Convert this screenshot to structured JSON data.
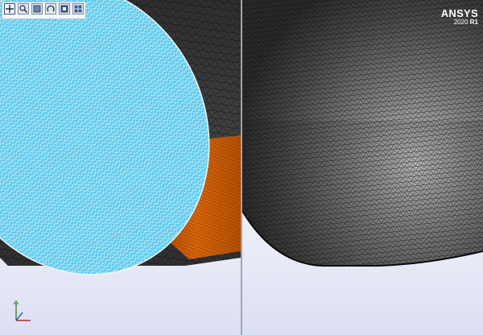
{
  "toolbar": {
    "buttons": [
      {
        "icon": "fit-view-icon",
        "active": true
      },
      {
        "icon": "zoom-box-icon",
        "active": false
      },
      {
        "icon": "pan-view-icon",
        "active": false
      },
      {
        "icon": "rotate-view-icon",
        "active": false
      },
      {
        "icon": "layout-view-icon",
        "active": false
      },
      {
        "icon": "multi-view-icon",
        "active": false
      }
    ]
  },
  "branding": {
    "product": "ANSYS",
    "year": "2020",
    "release": "R1"
  },
  "colors": {
    "inlet_face": "#5ac8ec",
    "outlet_face": "#e0640a",
    "wall_surface": "#3a3a3a",
    "mesh_lines": "#101010",
    "mesh_lines_light": "#ffffff",
    "background_top": "#ffffff",
    "background_bottom": "#dcdff3"
  },
  "triad": {
    "axis_colors": [
      "#c00000",
      "#2a7a2a",
      "#2040c0"
    ]
  }
}
